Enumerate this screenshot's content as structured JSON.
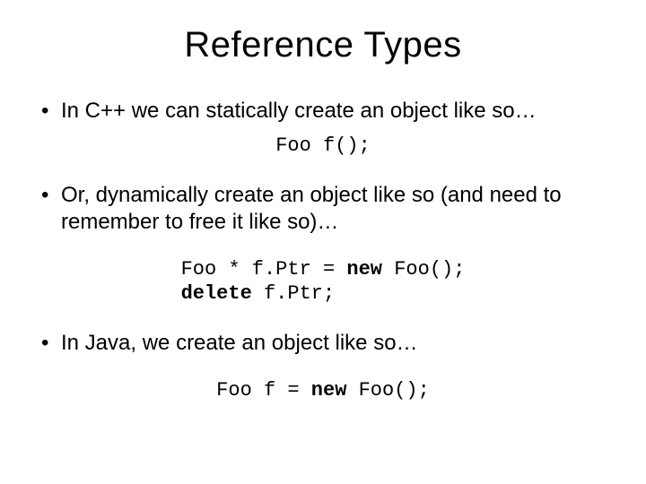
{
  "title": "Reference Types",
  "bullets": {
    "b1": "In C++ we can statically create an object like so…",
    "b2": "Or, dynamically create an object like so (and need to remember to free it like so)…",
    "b3": "In Java, we create an object like so…"
  },
  "code": {
    "c1": "Foo f();",
    "c2a_pre": "Foo * f.Ptr = ",
    "c2a_kw": "new",
    "c2a_post": " Foo();",
    "c2b_kw": "delete",
    "c2b_post": " f.Ptr;",
    "c3_pre": "Foo f = ",
    "c3_kw": "new",
    "c3_post": " Foo();"
  }
}
